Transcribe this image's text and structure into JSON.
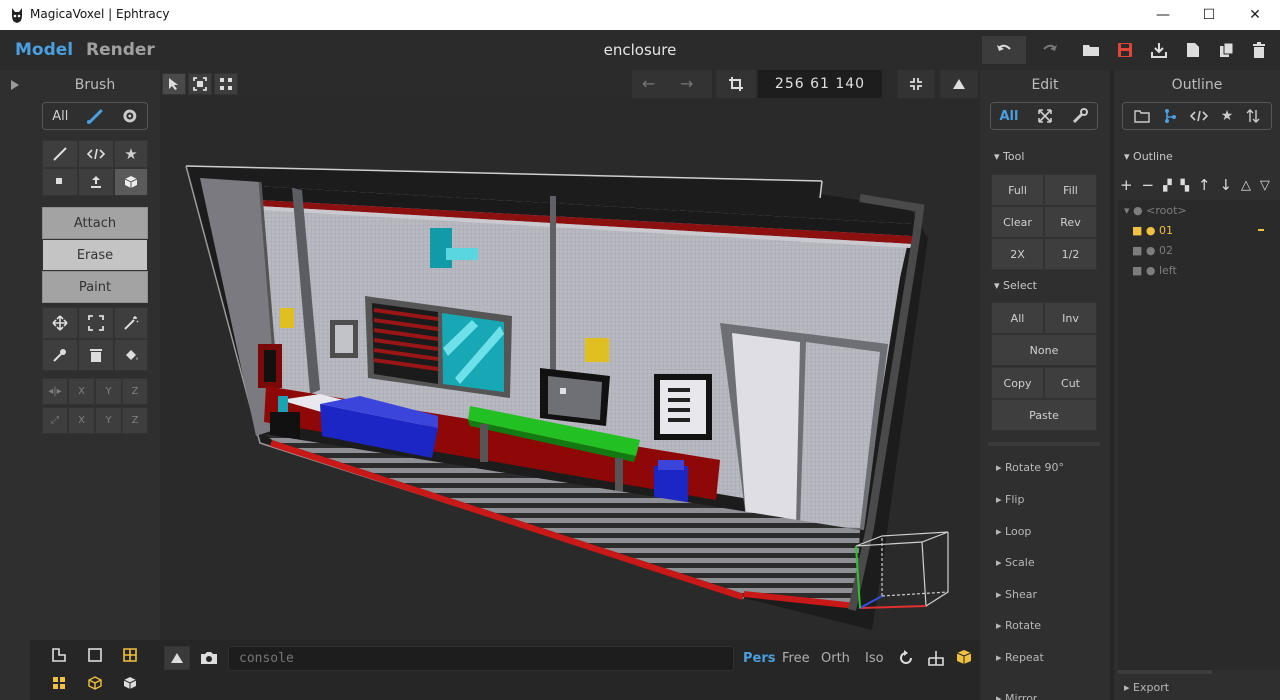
{
  "window": {
    "title": "MagicaVoxel | Ephtracy",
    "minimize": "—",
    "maximize": "☐",
    "close": "✕"
  },
  "appbar": {
    "mode_model": "Model",
    "mode_render": "Render",
    "document": "enclosure",
    "accent": "#4a9fe0",
    "save_color": "#e0453a"
  },
  "brush": {
    "title": "Brush",
    "filter_all": "All",
    "modes": [
      "Attach",
      "Erase",
      "Paint"
    ],
    "axis": [
      "X",
      "Y",
      "Z"
    ]
  },
  "viewport_bar": {
    "dimensions": "256 61 140"
  },
  "edit": {
    "title": "Edit",
    "filter_all": "All",
    "tool_section": "Tool",
    "tool_buttons": [
      "Full",
      "Fill",
      "Clear",
      "Rev",
      "2X",
      "1/2"
    ],
    "select_section": "Select",
    "select_buttons": [
      "All",
      "Inv",
      "None",
      "Copy",
      "Cut",
      "Paste"
    ],
    "collapsed": [
      "Rotate 90°",
      "Flip",
      "Loop",
      "Scale",
      "Shear",
      "Rotate",
      "Repeat",
      "Mirror"
    ]
  },
  "outline": {
    "title": "Outline",
    "section": "Outline",
    "tree": [
      {
        "label": "<root>",
        "active": false
      },
      {
        "label": "01",
        "active": true
      },
      {
        "label": "02",
        "active": false
      },
      {
        "label": "left",
        "active": false
      }
    ],
    "export": "Export",
    "active_color": "#f0c040"
  },
  "bottom": {
    "console_placeholder": "console",
    "views": [
      "Pers",
      "Free",
      "Orth",
      "Iso"
    ]
  }
}
